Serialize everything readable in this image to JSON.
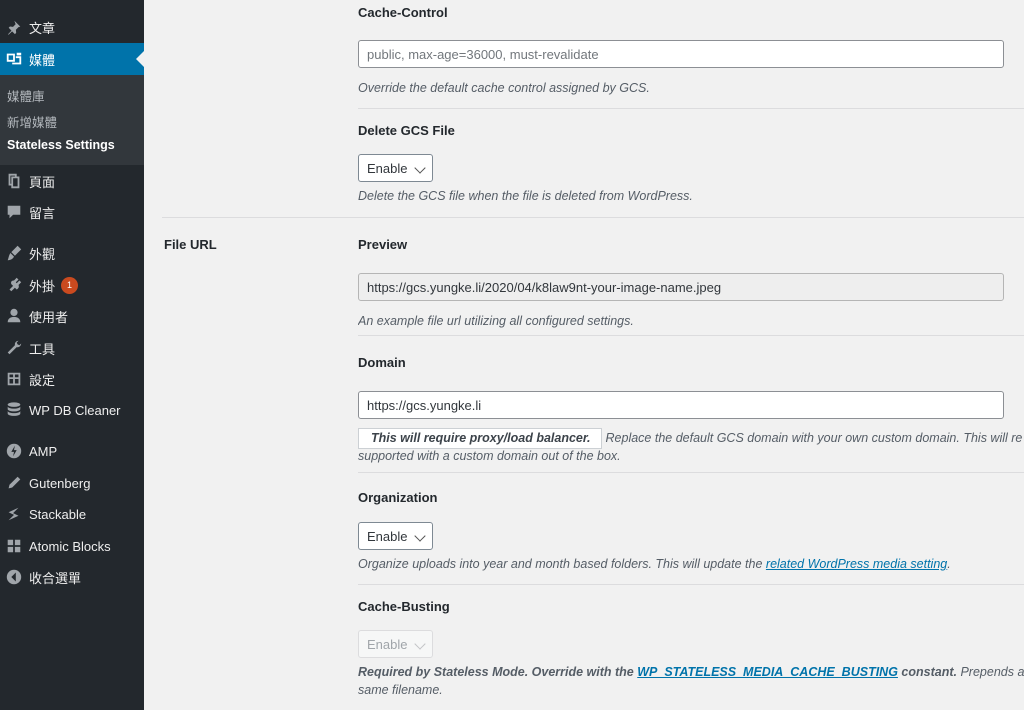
{
  "sidebar": {
    "posts": "文章",
    "media": "媒體",
    "media_sub": [
      "媒體庫",
      "新增媒體",
      "Stateless Settings"
    ],
    "pages": "頁面",
    "comments": "留言",
    "appearance": "外觀",
    "plugins": "外掛",
    "plugins_badge": "1",
    "users": "使用者",
    "tools": "工具",
    "settings": "設定",
    "wpdb": "WP DB Cleaner",
    "amp": "AMP",
    "gutenberg": "Gutenberg",
    "stackable": "Stackable",
    "atomic": "Atomic Blocks",
    "collapse": "收合選單"
  },
  "cache_control": {
    "title": "Cache-Control",
    "placeholder": "public, max-age=36000, must-revalidate",
    "desc": "Override the default cache control assigned by GCS."
  },
  "delete_gcs": {
    "title": "Delete GCS File",
    "value": "Enable",
    "desc": "Delete the GCS file when the file is deleted from WordPress."
  },
  "file_url": {
    "label": "File URL",
    "preview_title": "Preview",
    "preview_value": "https://gcs.yungke.li/2020/04/k8law9nt-your-image-name.jpeg",
    "preview_desc": "An example file url utilizing all configured settings."
  },
  "domain": {
    "title": "Domain",
    "value": "https://gcs.yungke.li",
    "note": "This will require proxy/load balancer.",
    "desc_line1": "Replace the default GCS domain with your own custom domain. This will re",
    "desc_line2": "supported with a custom domain out of the box."
  },
  "organization": {
    "title": "Organization",
    "value": "Enable",
    "desc_prefix": "Organize uploads into year and month based folders. This will update the",
    "desc_link": "related WordPress media setting",
    "desc_suffix": "."
  },
  "cache_busting": {
    "title": "Cache-Busting",
    "value": "Enable",
    "desc_prefix": "Required by Stateless Mode. Override with the",
    "desc_link": "WP_STATELESS_MEDIA_CACHE_BUSTING",
    "desc_mid": "constant.",
    "desc_suffix": "Prepends a rando",
    "desc_line2": "same filename."
  }
}
